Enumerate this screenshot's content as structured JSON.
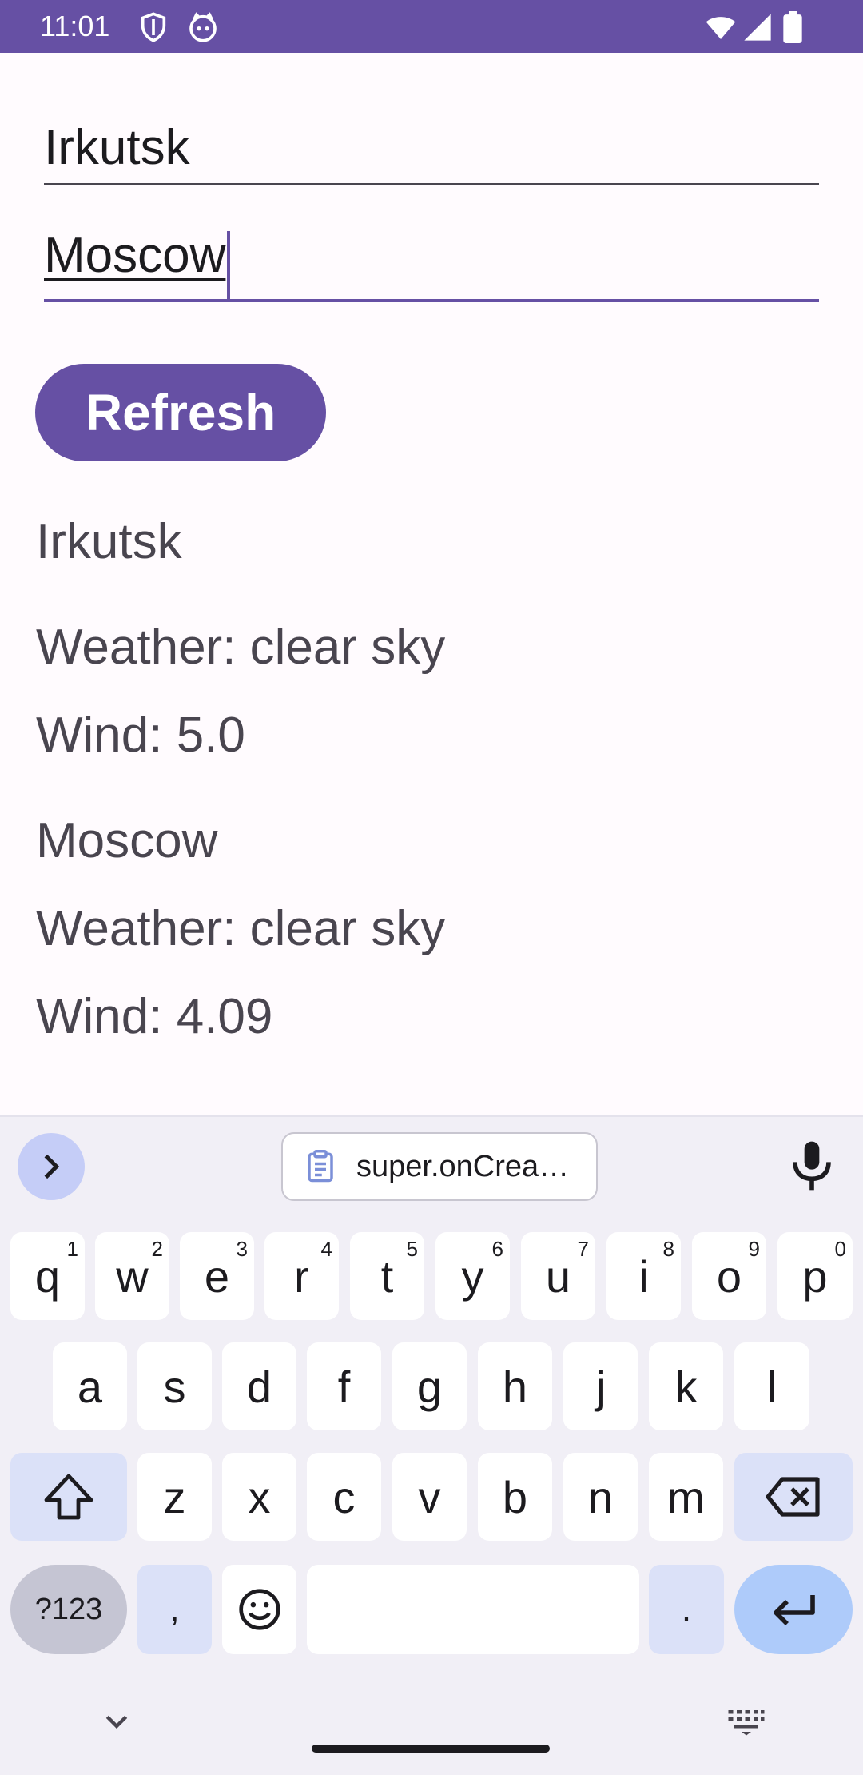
{
  "status_bar": {
    "time": "11:01",
    "icons": [
      "shield-icon",
      "cat-face-icon",
      "wifi-icon",
      "signal-icon",
      "battery-icon"
    ],
    "color": "#6650a4"
  },
  "inputs": {
    "city1_value": "Irkutsk",
    "city2_value": "Moscow"
  },
  "refresh_button": {
    "label": "Refresh",
    "color": "#6650a4"
  },
  "results": {
    "city1": {
      "name": "Irkutsk",
      "weather": "Weather: clear sky",
      "wind": "Wind: 5.0"
    },
    "city2": {
      "name": "Moscow",
      "weather": "Weather: clear sky",
      "wind": "Wind: 4.09"
    }
  },
  "keyboard": {
    "clipboard_suggestion": "super.onCrea…",
    "row1": [
      {
        "key": "q",
        "hint": "1"
      },
      {
        "key": "w",
        "hint": "2"
      },
      {
        "key": "e",
        "hint": "3"
      },
      {
        "key": "r",
        "hint": "4"
      },
      {
        "key": "t",
        "hint": "5"
      },
      {
        "key": "y",
        "hint": "6"
      },
      {
        "key": "u",
        "hint": "7"
      },
      {
        "key": "i",
        "hint": "8"
      },
      {
        "key": "o",
        "hint": "9"
      },
      {
        "key": "p",
        "hint": "0"
      }
    ],
    "row2": [
      "a",
      "s",
      "d",
      "f",
      "g",
      "h",
      "j",
      "k",
      "l"
    ],
    "row3": [
      "z",
      "x",
      "c",
      "v",
      "b",
      "n",
      "m"
    ],
    "symbols_label": "?123",
    "comma_label": ",",
    "period_label": ".",
    "accent_color": "#aecbfa"
  }
}
